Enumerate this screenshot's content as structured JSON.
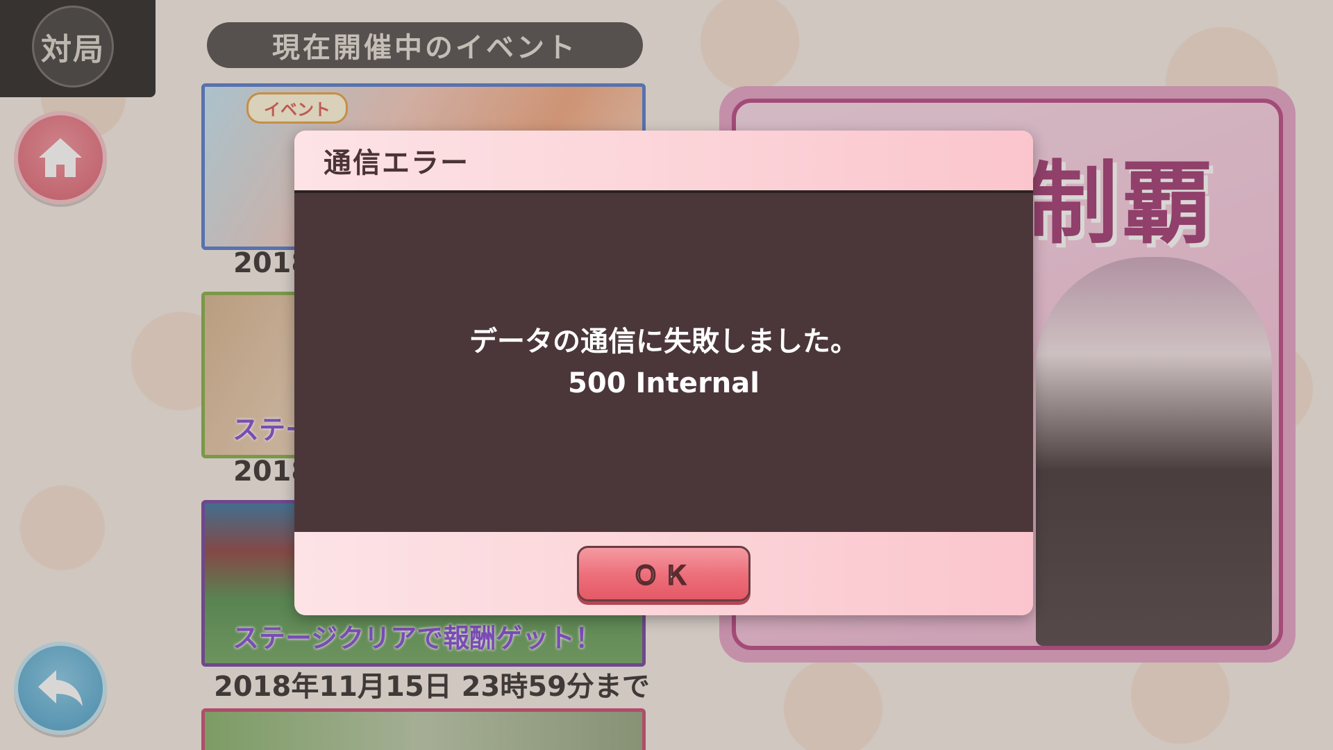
{
  "mode_tab": {
    "label": "対局"
  },
  "events": {
    "header": "現在開催中のイベント",
    "banners": [
      {
        "badge": "イベント",
        "date": "2018"
      },
      {
        "caption": "ステー",
        "date": "2018"
      },
      {
        "caption": "ステージクリアで報酬ゲット！",
        "date": "2018年11月15日 23時59分まで"
      },
      {
        "caption": ""
      }
    ]
  },
  "feature": {
    "title": "制覇"
  },
  "dialog": {
    "title": "通信エラー",
    "message": "データの通信に失敗しました。",
    "detail": "500 Internal",
    "ok_label": "ＯＫ"
  },
  "icons": {
    "home": "home-icon",
    "back": "back-arrow-icon"
  },
  "colors": {
    "dialog_body": "#4b373a",
    "dialog_header": "#fbd2d7",
    "ok_button": "#ec6d79",
    "home_button": "#d95667",
    "back_button": "#3e98c5"
  }
}
